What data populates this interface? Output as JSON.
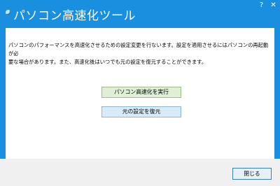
{
  "window": {
    "title": "パソコン高速化ツール",
    "help_label": "?",
    "close_label": "✕"
  },
  "content": {
    "description": "パソコンのパフォーマンスを高速化させるための設定変更を行ないます。設定を適用させるにはパソコンの再起動が必\n要な場合があります。また、高速化後はいつでも元の設定を復元することができます。"
  },
  "buttons": {
    "optimize_label": "パソコン高速化を実行",
    "restore_label": "元の設定を復元",
    "close_label": "閉じる"
  },
  "colors": {
    "title_bar": "#1a8fe0",
    "optimize_bg": "#dfeed5",
    "restore_bg": "#d8ebfb"
  }
}
